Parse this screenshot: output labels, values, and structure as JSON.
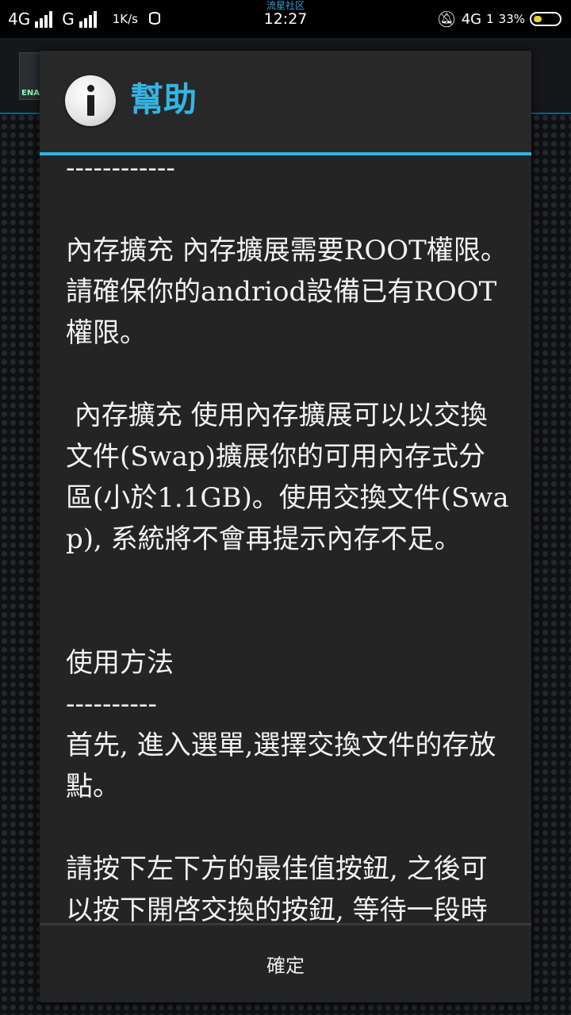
{
  "status_bar": {
    "network_1": "4G",
    "network_2": "G",
    "speed": "1K/s",
    "carrier": "流星社区",
    "time": "12:27",
    "right_network": "4G",
    "right_sub": "1",
    "battery_percent": "33%",
    "battery_level": 0.33,
    "icons": [
      "signal-icon",
      "database-icon",
      "bell-muted-icon",
      "battery-icon"
    ]
  },
  "background_app": {
    "logo_text": "ENA"
  },
  "dialog": {
    "title": "幫助",
    "icon": "info-icon",
    "accent_color": "#33b5e5",
    "body_text": "------------\n\n內存擴充 內存擴展需要ROOT權限。請確保你的andriod設備已有ROOT權限。\n\n 內存擴充 使用內存擴展可以以交換文件(Swap)擴展你的可用內存式分區(小於1.1GB)。使用交換文件(Swap), 系統將不會再提示內存不足。\n\n\n使用方法\n----------\n首先, 進入選單,選擇交換文件的存放點。\n\n請按下左下方的最佳值按鈕, 之後可以按下開啓交換的按鈕, 等待一段時間, 在使用中的記憶卡的使",
    "ok_button": "確定"
  }
}
